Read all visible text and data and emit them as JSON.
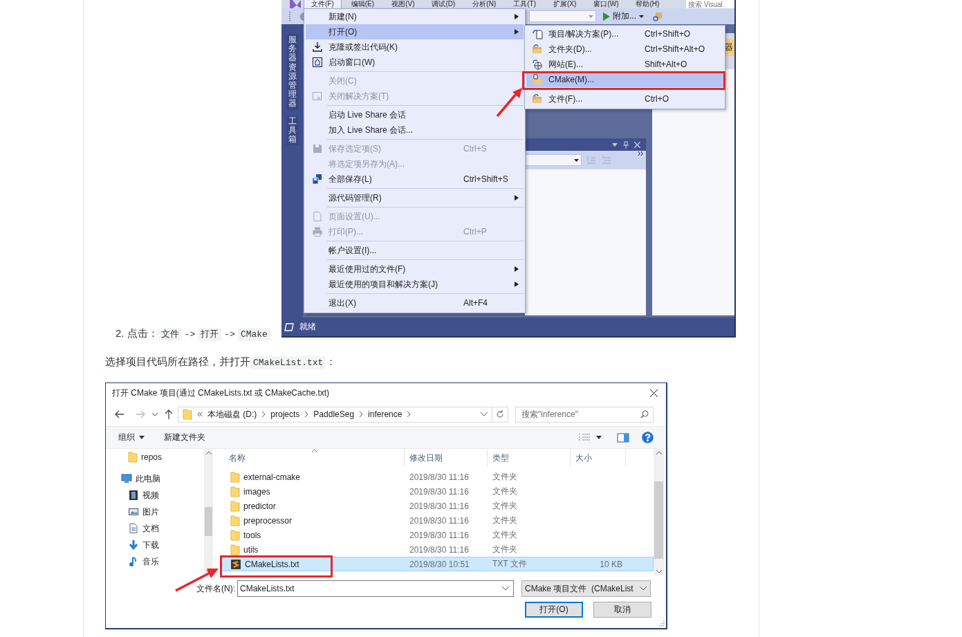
{
  "vs_window": {
    "menu_bar": [
      {
        "label": "文件(F)",
        "selected": true
      },
      {
        "label": "编辑(E)",
        "selected": false
      },
      {
        "label": "视图(V)",
        "selected": false
      },
      {
        "label": "调试(D)",
        "selected": false
      },
      {
        "label": "分析(N)",
        "selected": false
      },
      {
        "label": "工具(T)",
        "selected": false
      },
      {
        "label": "扩展(X)",
        "selected": false
      },
      {
        "label": "窗口(W)",
        "selected": false
      },
      {
        "label": "帮助(H)",
        "selected": false
      }
    ],
    "search": {
      "placeholder": "搜索 Visual"
    },
    "attach_button": "附加...",
    "side_tabs": [
      "服务器资源管理器",
      "工具箱"
    ],
    "right_panel_tab": "器",
    "file_menu": [
      {
        "kind": "item",
        "label": "新建(N)",
        "submenu": true,
        "disabled": false,
        "selected": false,
        "icon": false
      },
      {
        "kind": "item",
        "label": "打开(O)",
        "submenu": true,
        "disabled": false,
        "selected": true,
        "icon": false
      },
      {
        "kind": "item",
        "label": "克隆或签出代码(K)",
        "submenu": false,
        "disabled": false,
        "selected": false,
        "icon": true
      },
      {
        "kind": "item",
        "label": "启动窗口(W)",
        "submenu": false,
        "disabled": false,
        "selected": false,
        "icon": true
      },
      {
        "kind": "separator"
      },
      {
        "kind": "item",
        "label": "关闭(C)",
        "submenu": false,
        "disabled": true,
        "selected": false,
        "icon": false
      },
      {
        "kind": "item",
        "label": "关闭解决方案(T)",
        "submenu": false,
        "disabled": true,
        "selected": false,
        "icon": true
      },
      {
        "kind": "separator"
      },
      {
        "kind": "item",
        "label": "启动 Live Share 会话",
        "submenu": false,
        "disabled": false,
        "selected": false,
        "icon": false
      },
      {
        "kind": "item",
        "label": "加入 Live Share 会话...",
        "submenu": false,
        "disabled": false,
        "selected": false,
        "icon": false
      },
      {
        "kind": "separator"
      },
      {
        "kind": "item",
        "label": "保存选定项(S)",
        "shortcut": "Ctrl+S",
        "submenu": false,
        "disabled": true,
        "selected": false,
        "icon": true
      },
      {
        "kind": "item",
        "label": "将选定项另存为(A)...",
        "submenu": false,
        "disabled": true,
        "selected": false,
        "icon": false
      },
      {
        "kind": "item",
        "label": "全部保存(L)",
        "shortcut": "Ctrl+Shift+S",
        "submenu": false,
        "disabled": false,
        "selected": false,
        "icon": true
      },
      {
        "kind": "separator"
      },
      {
        "kind": "item",
        "label": "源代码管理(R)",
        "submenu": true,
        "disabled": false,
        "selected": false,
        "icon": false
      },
      {
        "kind": "separator"
      },
      {
        "kind": "item",
        "label": "页面设置(U)...",
        "submenu": false,
        "disabled": true,
        "selected": false,
        "icon": true
      },
      {
        "kind": "item",
        "label": "打印(P)...",
        "shortcut": "Ctrl+P",
        "submenu": false,
        "disabled": true,
        "selected": false,
        "icon": true
      },
      {
        "kind": "separator"
      },
      {
        "kind": "item",
        "label": "帐户设置(I)...",
        "submenu": false,
        "disabled": false,
        "selected": false,
        "icon": false
      },
      {
        "kind": "separator"
      },
      {
        "kind": "item",
        "label": "最近使用过的文件(F)",
        "submenu": true,
        "disabled": false,
        "selected": false,
        "icon": false
      },
      {
        "kind": "item",
        "label": "最近使用的项目和解决方案(J)",
        "submenu": true,
        "disabled": false,
        "selected": false,
        "icon": false
      },
      {
        "kind": "separator"
      },
      {
        "kind": "item",
        "label": "退出(X)",
        "shortcut": "Alt+F4",
        "submenu": false,
        "disabled": false,
        "selected": false,
        "icon": false
      }
    ],
    "open_submenu": [
      {
        "label": "项目/解决方案(P)...",
        "shortcut": "Ctrl+Shift+O",
        "selected": false
      },
      {
        "label": "文件夹(D)...",
        "shortcut": "Ctrl+Shift+Alt+O",
        "selected": false
      },
      {
        "label": "网站(E)...",
        "shortcut": "Shift+Alt+O",
        "selected": false
      },
      {
        "label": "CMake(M)...",
        "selected": true
      },
      {
        "label": "文件(F)...",
        "shortcut": "Ctrl+O",
        "selected": false
      }
    ],
    "status_bar": "就绪"
  },
  "step": {
    "number": "2.",
    "label": "点击：",
    "path": [
      {
        "kind": "code",
        "text": "文件"
      },
      {
        "kind": "text",
        "text": "->"
      },
      {
        "kind": "code",
        "text": "打开"
      },
      {
        "kind": "text",
        "text": "->"
      },
      {
        "kind": "code",
        "text": "CMake"
      }
    ]
  },
  "instruction": [
    {
      "kind": "text",
      "text": "选择项目代码所在路径，并打开"
    },
    {
      "kind": "code",
      "text": "CMakeList.txt"
    },
    {
      "kind": "text",
      "text": "："
    }
  ],
  "dialog": {
    "title": "打开 CMake 项目(通过 CMakeLists.txt 或 CMakeCache.txt)",
    "breadcrumbs": [
      "本地磁盘 (D:)",
      "projects",
      "PaddleSeg",
      "inference"
    ],
    "search_placeholder": "搜索\"inference\"",
    "organize": "组织",
    "new_folder": "新建文件夹",
    "nav": [
      {
        "label": "repos",
        "kind": "folder"
      },
      {
        "label": "此电脑",
        "kind": "root"
      },
      {
        "label": "视频",
        "kind": "library"
      },
      {
        "label": "图片",
        "kind": "library"
      },
      {
        "label": "文档",
        "kind": "library"
      },
      {
        "label": "下载",
        "kind": "library"
      },
      {
        "label": "音乐",
        "kind": "library"
      }
    ],
    "columns": [
      "名称",
      "修改日期",
      "类型",
      "大小"
    ],
    "files": [
      {
        "name": "external-cmake",
        "modified": "2019/8/30 11:16",
        "type": "文件夹",
        "kind": "folder",
        "selected": false
      },
      {
        "name": "images",
        "modified": "2019/8/30 11:16",
        "type": "文件夹",
        "kind": "folder",
        "selected": false
      },
      {
        "name": "predictor",
        "modified": "2019/8/30 11:16",
        "type": "文件夹",
        "kind": "folder",
        "selected": false
      },
      {
        "name": "preprocessor",
        "modified": "2019/8/30 11:16",
        "type": "文件夹",
        "kind": "folder",
        "selected": false
      },
      {
        "name": "tools",
        "modified": "2019/8/30 11:16",
        "type": "文件夹",
        "kind": "folder",
        "selected": false
      },
      {
        "name": "utils",
        "modified": "2019/8/30 11:16",
        "type": "文件夹",
        "kind": "folder",
        "selected": false
      },
      {
        "name": "CMakeLists.txt",
        "modified": "2019/8/30 10:51",
        "type": "TXT 文件",
        "size": "10 KB",
        "kind": "file",
        "selected": true
      }
    ],
    "file_name_label": "文件名(N):",
    "file_name": "CMakeLists.txt",
    "file_type": "CMake 项目文件  (CMakeList",
    "buttons": [
      {
        "label": "打开(O)",
        "default": true
      },
      {
        "label": "取消",
        "default": false
      }
    ]
  }
}
